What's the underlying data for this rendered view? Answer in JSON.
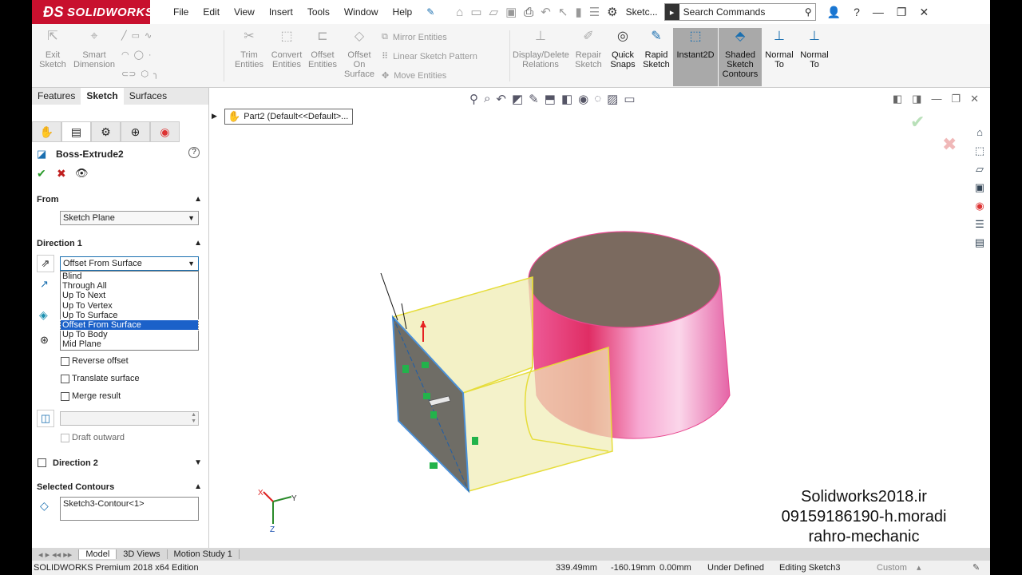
{
  "app": {
    "logo": "SOLIDWORKS",
    "doc_title": "Sketc..."
  },
  "menu": [
    "File",
    "Edit",
    "View",
    "Insert",
    "Tools",
    "Window",
    "Help"
  ],
  "search": {
    "placeholder": "Search Commands"
  },
  "ribbon": {
    "exit_sketch": "Exit Sketch",
    "smart_dimension": "Smart Dimension",
    "trim_entities": "Trim Entities",
    "convert_entities": "Convert Entities",
    "offset_entities": "Offset Entities",
    "offset_on_surface": "Offset On Surface",
    "mirror_entities": "Mirror Entities",
    "linear_sketch_pattern": "Linear Sketch Pattern",
    "move_entities": "Move Entities",
    "display_delete_relations": "Display/Delete Relations",
    "repair_sketch": "Repair Sketch",
    "quick_snaps": "Quick Snaps",
    "rapid_sketch": "Rapid Sketch",
    "instant2d": "Instant2D",
    "shaded_sketch_contours": "Shaded Sketch Contours",
    "normal_to_1": "Normal To",
    "normal_to_2": "Normal To"
  },
  "cm_tabs": [
    "Features",
    "Sketch",
    "Surfaces"
  ],
  "panel": {
    "feature_name": "Boss-Extrude2",
    "help": "?",
    "from_label": "From",
    "from_value": "Sketch Plane",
    "direction1_label": "Direction 1",
    "end_condition": "Offset From Surface",
    "end_condition_options": [
      "Blind",
      "Through All",
      "Up To Next",
      "Up To Vertex",
      "Up To Surface",
      "Offset From Surface",
      "Up To Body",
      "Mid Plane"
    ],
    "reverse_offset": "Reverse offset",
    "translate_surface": "Translate surface",
    "merge_result": "Merge result",
    "draft_outward": "Draft outward",
    "direction2_label": "Direction 2",
    "selected_contours_label": "Selected Contours",
    "selected_contours_value": "Sketch3-Contour<1>"
  },
  "viewport": {
    "breadcrumb": "Part2  (Default<<Default>..."
  },
  "watermark": [
    "Solidworks2018.ir",
    "09159186190-h.moradi",
    "rahro-mechanic"
  ],
  "bottom_tabs": [
    "Model",
    "3D Views",
    "Motion Study 1"
  ],
  "status": {
    "edition": "SOLIDWORKS Premium 2018 x64 Edition",
    "x": "339.49mm",
    "y": "-160.19mm",
    "z": "0.00mm",
    "state": "Under Defined",
    "editing": "Editing Sketch3",
    "units": "Custom"
  },
  "colors": {
    "brand": "#c8102e",
    "selection": "#1b61c9",
    "cylinder": "#e8488f",
    "extrude_preview": "#e8e4a0"
  }
}
